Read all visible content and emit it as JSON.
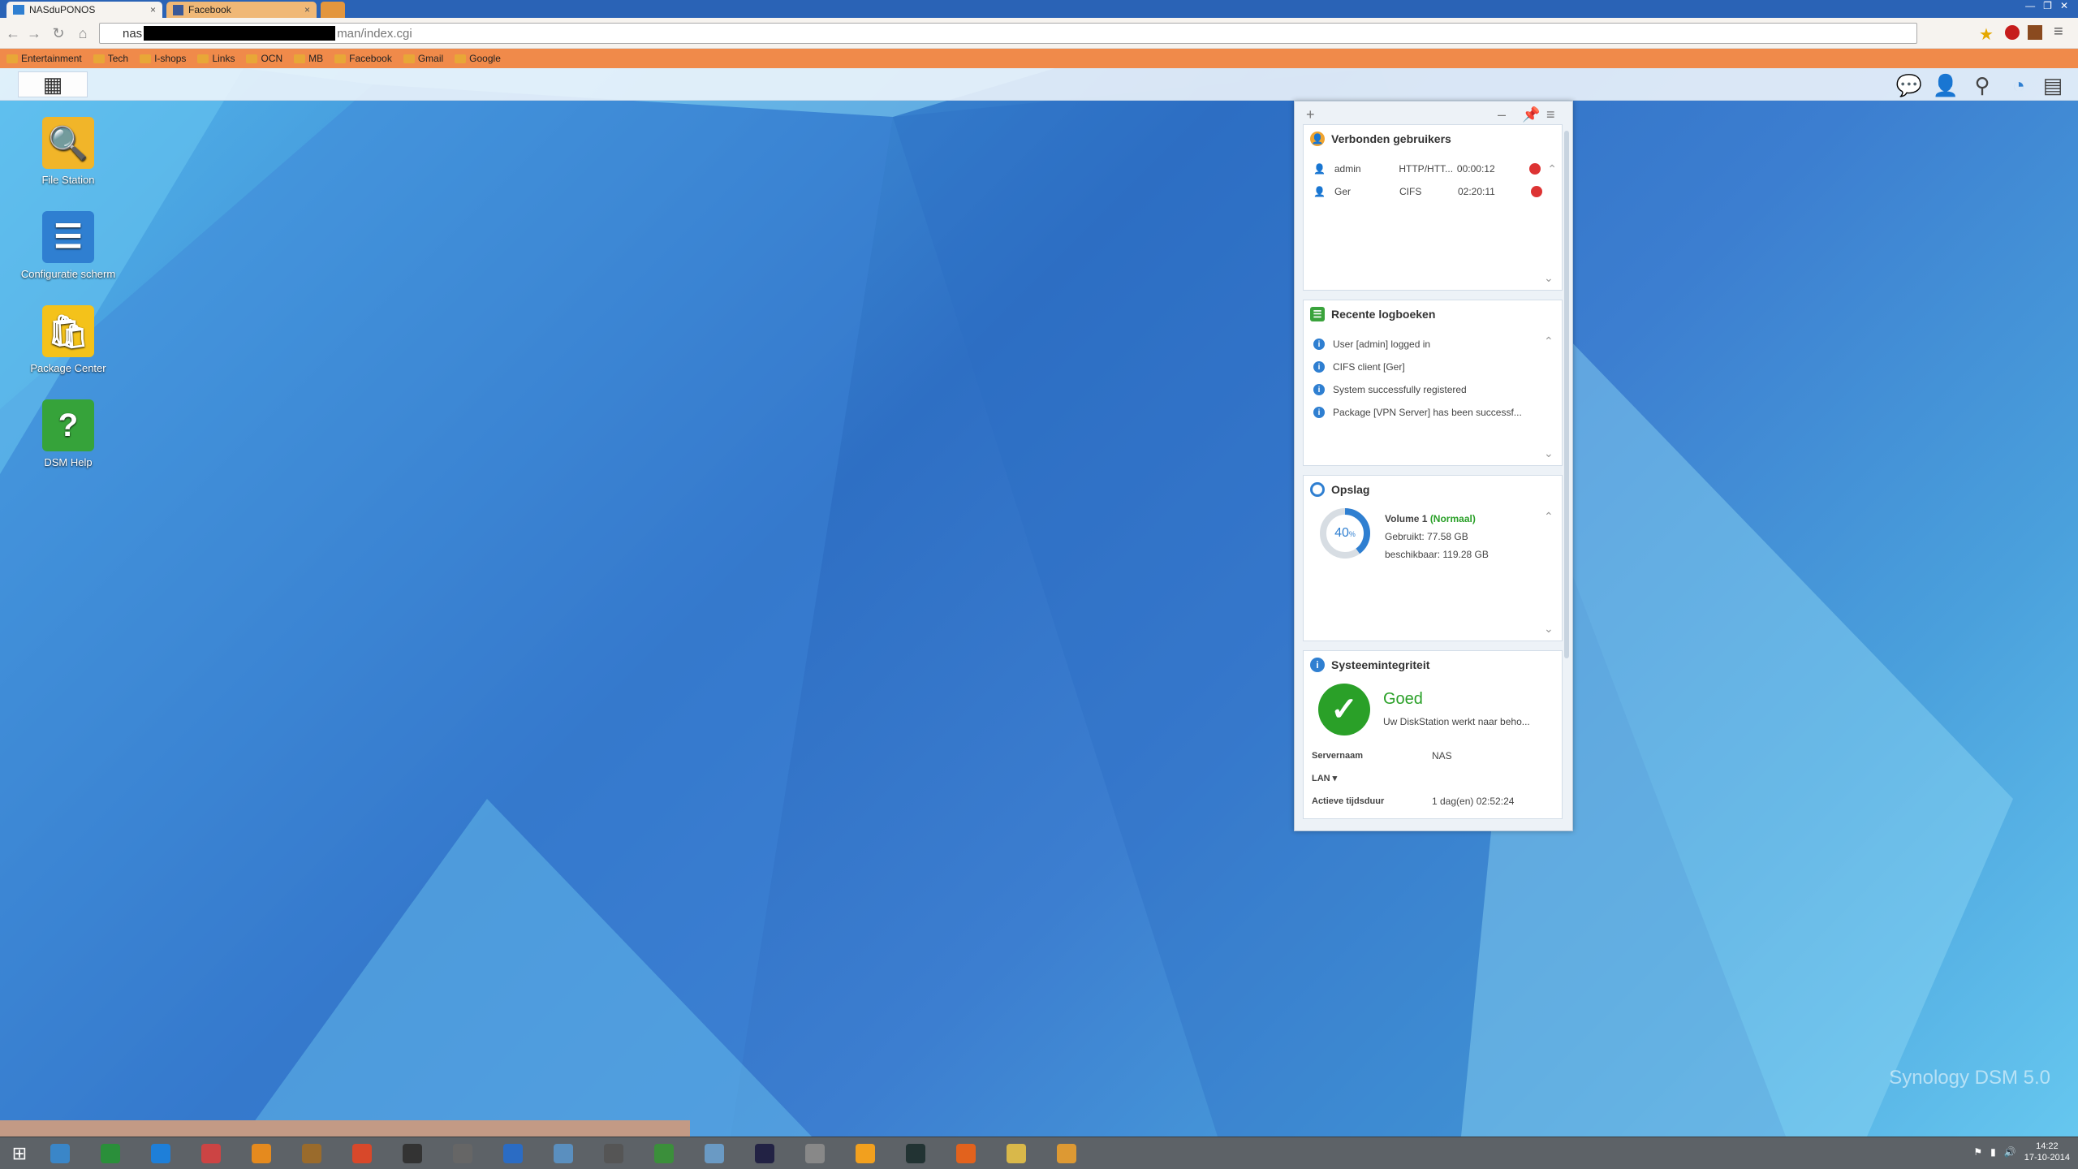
{
  "browser": {
    "tabs": [
      {
        "title": "NASduPONOS"
      },
      {
        "title": "Facebook"
      }
    ],
    "close_glyph": "×",
    "address": {
      "prefix": "nas",
      "suffix": "man/index.cgi"
    },
    "nav_icons": [
      "back-icon",
      "forward-icon",
      "reload-icon",
      "home-icon"
    ],
    "bookmarks": [
      "Entertainment",
      "Tech",
      "I-shops",
      "Links",
      "OCN",
      "MB",
      "Facebook",
      "Gmail",
      "Google"
    ]
  },
  "desktop": {
    "icons": [
      {
        "label": "File Station",
        "color": "#f1b529",
        "glyph": "🔍"
      },
      {
        "label": "Configuratie scherm",
        "color": "#2f7fd1",
        "glyph": "☰"
      },
      {
        "label": "Package Center",
        "color": "#f4c21a",
        "glyph": "🛍"
      },
      {
        "label": "DSM Help",
        "color": "#36a33a",
        "glyph": "?"
      }
    ],
    "watermark": "Synology DSM 5.0"
  },
  "widgets": {
    "connected_users": {
      "title": "Verbonden gebruikers",
      "rows": [
        {
          "user": "admin",
          "protocol": "HTTP/HTT...",
          "time": "00:00:12"
        },
        {
          "user": "Ger",
          "protocol": "CIFS",
          "time": "02:20:11"
        }
      ]
    },
    "logs": {
      "title": "Recente logboeken",
      "rows": [
        "User [admin] logged in",
        "CIFS client [Ger]",
        "System successfully registered",
        "Package [VPN Server] has been successf..."
      ]
    },
    "storage": {
      "title": "Opslag",
      "percent": 40,
      "percent_label": "40",
      "percent_sign": "%",
      "volume": "Volume 1",
      "status": "(Normaal)",
      "used": "Gebruikt: 77.58 GB",
      "available": "beschikbaar: 119.28 GB"
    },
    "health": {
      "title": "Systeemintegriteit",
      "status": "Goed",
      "description": "Uw DiskStation werkt naar beho...",
      "server_label": "Servernaam",
      "server_value": "NAS",
      "lan_label": "LAN ▾",
      "uptime_label": "Actieve tijdsduur",
      "uptime_value": "1 dag(en) 02:52:24"
    }
  },
  "taskbar": {
    "clock_time": "14:22",
    "clock_date": "17-10-2014"
  },
  "colors": {
    "accent": "#2f7fd1",
    "good": "#2aa028",
    "tab_active": "#f6f3ef",
    "bookmark_bar": "#f08a4a"
  }
}
